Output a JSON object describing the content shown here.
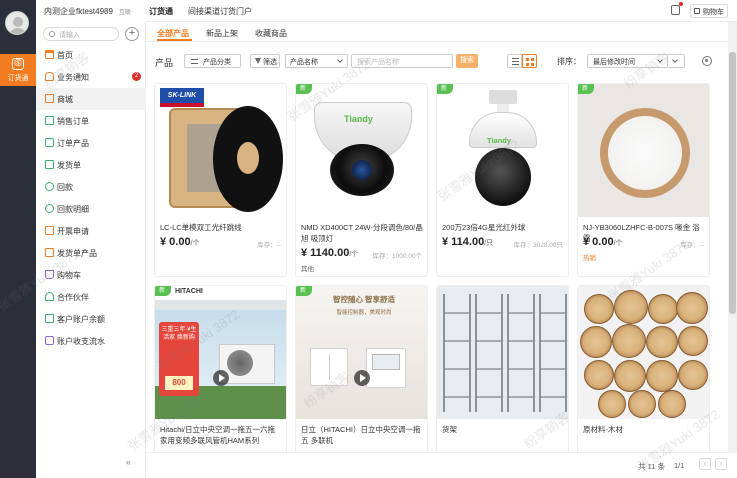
{
  "rail": {
    "app_label": "订货通",
    "app_icon": "Ⓢ"
  },
  "company": {
    "name": "内测企业fktest4989",
    "switch_label": "互联"
  },
  "sidebar": {
    "search_placeholder": "请输入",
    "items": [
      {
        "label": "首页",
        "icon": "home-icon"
      },
      {
        "label": "业务通知",
        "icon": "bell-icon",
        "badge": "2"
      },
      {
        "label": "商城",
        "icon": "shop-icon"
      },
      {
        "label": "销售订单",
        "icon": "order-icon"
      },
      {
        "label": "订单产品",
        "icon": "order-product-icon"
      },
      {
        "label": "发货单",
        "icon": "delivery-icon"
      },
      {
        "label": "回款",
        "icon": "payment-icon"
      },
      {
        "label": "回款明细",
        "icon": "payment-detail-icon"
      },
      {
        "label": "开票申请",
        "icon": "invoice-icon"
      },
      {
        "label": "发货单产品",
        "icon": "delivery-product-icon"
      },
      {
        "label": "购物车",
        "icon": "cart-icon"
      },
      {
        "label": "合作伙伴",
        "icon": "partner-icon"
      },
      {
        "label": "客户账户余额",
        "icon": "balance-icon"
      },
      {
        "label": "账户收支流水",
        "icon": "ledger-icon"
      }
    ],
    "collapse_label": "«"
  },
  "header": {
    "app_name": "订货通",
    "portal_link": "间接渠道订货门户",
    "cart_label": "购物车"
  },
  "tabs": [
    {
      "label": "全部产品"
    },
    {
      "label": "新品上架"
    },
    {
      "label": "收藏商品"
    }
  ],
  "filters": {
    "title": "产品",
    "category_label": "产品分类",
    "filter_label": "筛选",
    "field_value": "产品名称",
    "keyword_placeholder": "搜索产品名称",
    "search_label": "搜索",
    "sort_label": "排序：",
    "sort_value": "最后修改时间"
  },
  "products": [
    {
      "name": "LC-LC单模双工光纤跳线",
      "price": "¥ 0.00",
      "unit": "/个",
      "stock": "库存：--",
      "is_new": false
    },
    {
      "name": "NMD XD400CT 24W-分段调色/80/晶旭 吸顶灯",
      "price": "¥ 1140.00",
      "unit": "/个",
      "stock": "库存：1000.00个",
      "note": "其他",
      "is_new": true
    },
    {
      "name": "200万23倍4G星光红外球",
      "price": "¥ 114.00",
      "unit": "/只",
      "stock": "库存：3028.00只",
      "is_new": true
    },
    {
      "name": "NJ-YB3060LZHFC-B-007S 喙金 浴霸",
      "price": "¥ 0.00",
      "unit": "/个",
      "stock": "库存：--",
      "note": "热销",
      "is_new": true
    },
    {
      "name": "Hitachi/日立中央空调一拖五一六拖 家用变频多联风管机HAM系列",
      "price": "",
      "unit": "",
      "stock": "",
      "is_new": true
    },
    {
      "name": "日立（HITACHI）日立中央空调一拖五 多联机",
      "price": "",
      "unit": "",
      "stock": "",
      "is_new": true
    },
    {
      "name": "货架",
      "price": "",
      "unit": "",
      "stock": "",
      "is_new": false
    },
    {
      "name": "原材料-木材",
      "price": "",
      "unit": "",
      "stock": "",
      "is_new": false
    }
  ],
  "new_tag": "新",
  "image_text": {
    "cable_logo": "SK-LINK",
    "dome_brand": "Tiandy",
    "ptz_brand": "Tiandy",
    "ac_brand": "HITACHI",
    "ac_promo": "三重三年 ¥生活家 焕新购",
    "ac_price": "800",
    "panel_headline": "智控随心 智享舒适",
    "panel_sub": "智能控制器，美观时尚"
  },
  "watermark": "张雪雅Yuki 3872",
  "watermark_alt": "纷享销客",
  "pagination": {
    "total": "共 11 条",
    "pages": "1/1"
  },
  "colors": {
    "accent": "#f47c20",
    "rail": "#2b2f3a",
    "new_tag": "#58c152",
    "badge": "#e02d2d"
  }
}
